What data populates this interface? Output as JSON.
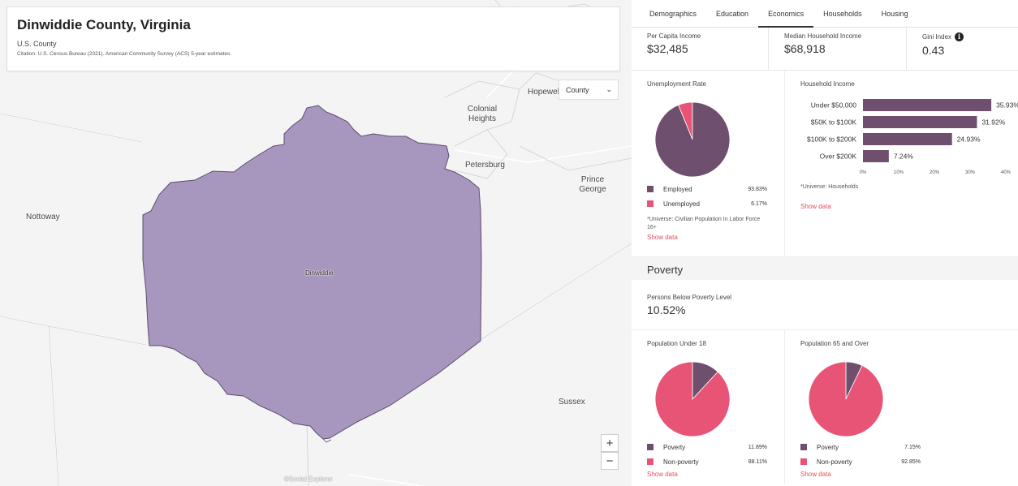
{
  "map": {
    "info": {
      "title": "Dinwiddie County, Virginia",
      "subtitle": "U.S. County",
      "citation": "Citation: U.S. Census Bureau (2021). American Community Survey (ACS) 5-year estimates."
    },
    "geo_level": {
      "value": "County"
    },
    "labels": {
      "hopewell": "Hopewel",
      "colonial_heights": "Colonial Heights",
      "petersburg": "Petersburg",
      "prince_george": "Prince George",
      "nottoway": "Nottoway",
      "dinwiddie": "Dinwiddie",
      "sussex": "Sussex"
    },
    "zoom_in": "+",
    "zoom_out": "−",
    "watermark": "©Social Explorer",
    "colors": {
      "county_fill": "#a796bd",
      "county_stroke": "#5e4d70",
      "background": "#f4f4f4"
    }
  },
  "tabs": [
    "Demographics",
    "Education",
    "Economics",
    "Households",
    "Housing"
  ],
  "active_tab": "Economics",
  "stats": {
    "per_capita": {
      "label": "Per Capita Income",
      "value": "$32,485"
    },
    "median_household": {
      "label": "Median Household Income",
      "value": "$68,918"
    },
    "gini": {
      "label": "Gini Index",
      "value": "0.43",
      "icon": "info-icon"
    }
  },
  "unemployment": {
    "title": "Unemployment Rate",
    "legend": [
      {
        "label": "Employed",
        "value": "93.83%"
      },
      {
        "label": "Unemployed",
        "value": "6.17%"
      }
    ],
    "footnote": "*Universe: Civilian Population In Labor Force 16+",
    "show_data": "Show data"
  },
  "household_income": {
    "title": "Household Income",
    "footnote": "*Universe: Households",
    "show_data": "Show data"
  },
  "poverty": {
    "header": "Poverty",
    "level_label": "Persons Below Poverty Level",
    "level_value": "10.52%",
    "under18": {
      "title": "Population Under 18",
      "legend": [
        {
          "label": "Poverty",
          "value": "11.89%"
        },
        {
          "label": "Non-poverty",
          "value": "88.11%"
        }
      ],
      "show_data": "Show data"
    },
    "over65": {
      "title": "Population 65 and Over",
      "legend": [
        {
          "label": "Poverty",
          "value": "7.15%"
        },
        {
          "label": "Non-poverty",
          "value": "92.85%"
        }
      ],
      "show_data": "Show data"
    }
  },
  "colors": {
    "purple": "#6e4f6e",
    "pink": "#e85475",
    "link": "#e05260"
  },
  "chart_data": [
    {
      "type": "pie",
      "title": "Unemployment Rate",
      "categories": [
        "Employed",
        "Unemployed"
      ],
      "values": [
        93.83,
        6.17
      ]
    },
    {
      "type": "bar",
      "orientation": "horizontal",
      "title": "Household Income",
      "categories": [
        "Under $50,000",
        "$50K to $100K",
        "$100K to $200K",
        "Over $200K"
      ],
      "values": [
        35.93,
        31.92,
        24.93,
        7.24
      ],
      "value_labels": [
        "35.93%",
        "31.92%",
        "24.93%",
        "7.24%"
      ],
      "xlim": [
        0,
        40
      ],
      "xticks": [
        "0%",
        "10%",
        "20%",
        "30%",
        "40%"
      ],
      "grid": false
    },
    {
      "type": "pie",
      "title": "Population Under 18",
      "categories": [
        "Poverty",
        "Non-poverty"
      ],
      "values": [
        11.89,
        88.11
      ]
    },
    {
      "type": "pie",
      "title": "Population 65 and Over",
      "categories": [
        "Poverty",
        "Non-poverty"
      ],
      "values": [
        7.15,
        92.85
      ]
    }
  ]
}
